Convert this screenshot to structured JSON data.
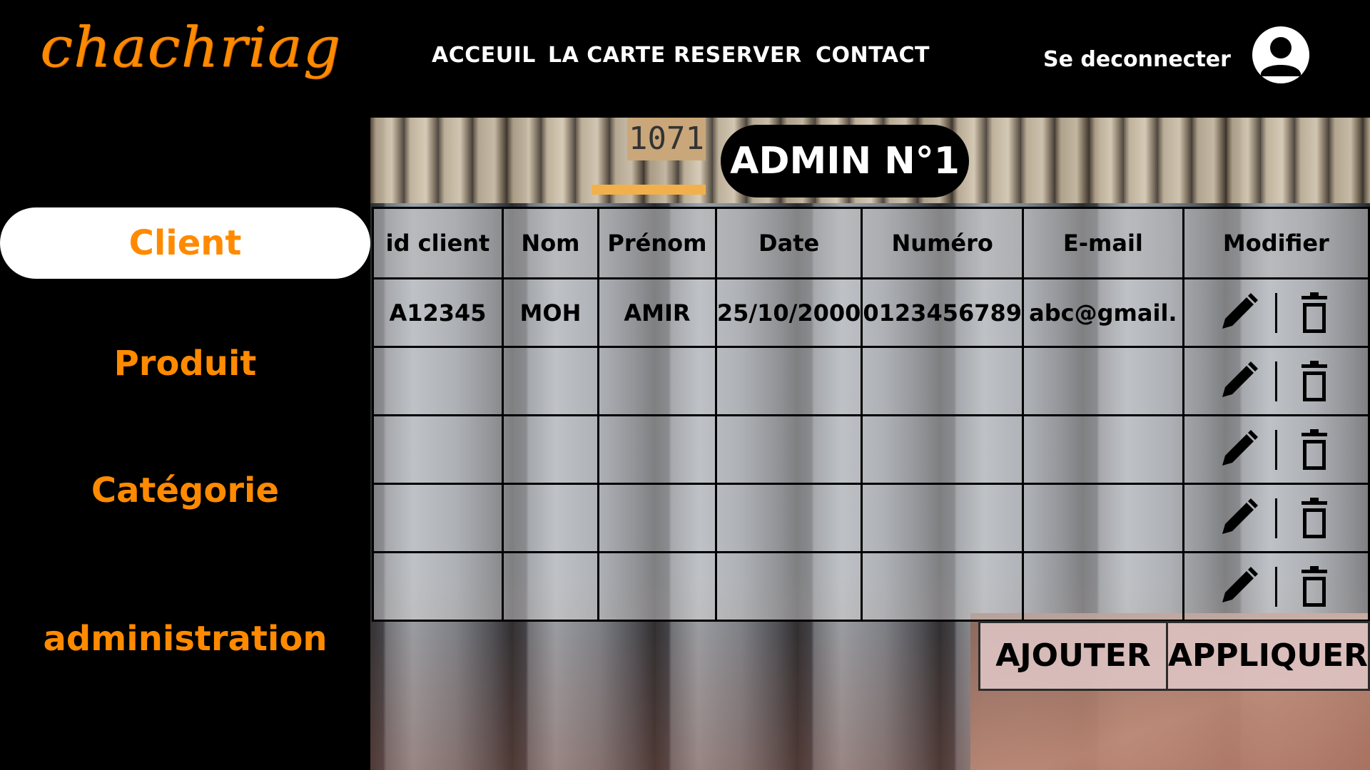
{
  "header": {
    "logo_text": "chachriag",
    "nav": [
      "ACCEUIL",
      "LA CARTE",
      "RESERVER",
      "CONTACT"
    ],
    "logout_label": "Se deconnecter",
    "avatar_icon": "user-avatar-icon"
  },
  "sidebar": {
    "items": [
      {
        "label": "Client",
        "active": true
      },
      {
        "label": "Produit",
        "active": false
      },
      {
        "label": "Catégorie",
        "active": false
      },
      {
        "label": "administration",
        "active": false
      }
    ]
  },
  "main": {
    "title": "ADMIN N°1",
    "table": {
      "headers": [
        "id client",
        "Nom",
        "Prénom",
        "Date",
        "Numéro",
        "E-mail",
        "Modifier"
      ],
      "rows": [
        [
          "A12345",
          "MOH",
          "AMIR",
          "25/10/2000",
          "0123456789",
          "abc@gmail."
        ],
        [
          "",
          "",
          "",
          "",
          "",
          ""
        ],
        [
          "",
          "",
          "",
          "",
          "",
          ""
        ],
        [
          "",
          "",
          "",
          "",
          "",
          ""
        ],
        [
          "",
          "",
          "",
          "",
          "",
          ""
        ]
      ],
      "row_actions": [
        "pencil-icon",
        "trash-icon"
      ]
    },
    "buttons": {
      "add_label": "AJOUTER",
      "apply_label": "APPLIQUER"
    },
    "background_labels": {
      "box_number": "1071"
    }
  },
  "colors": {
    "accent": "#ff8a00",
    "background": "#000000",
    "text_light": "#ffffff"
  }
}
